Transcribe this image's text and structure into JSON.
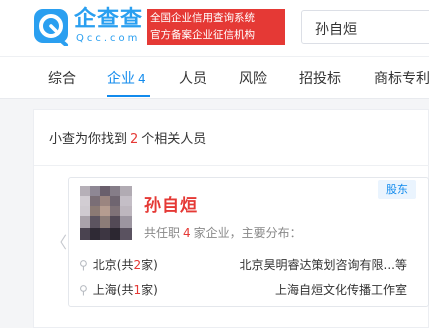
{
  "header": {
    "logo_text": "企查查",
    "logo_url": "Qcc.com",
    "slogan_line1": "全国企业信用查询系统",
    "slogan_line2": "官方备案企业征信机构",
    "search_value": "孙自烜"
  },
  "nav": {
    "tabs": [
      {
        "label": "综合"
      },
      {
        "label": "企业",
        "count": "4",
        "active": true
      },
      {
        "label": "人员"
      },
      {
        "label": "风险"
      },
      {
        "label": "招投标"
      },
      {
        "label": "商标专利"
      }
    ]
  },
  "results": {
    "prefix": "小查为你找到",
    "count": "2",
    "suffix": "个相关人员"
  },
  "person": {
    "name": "孙自烜",
    "tag": "股东",
    "info_prefix": "共任职",
    "info_count": "4",
    "info_suffix": "家企业，主要分布：",
    "locations": [
      {
        "city": "北京(共",
        "n": "2",
        "close": "家)",
        "company": "北京昊明睿达策划咨询有限...等"
      },
      {
        "city": "上海(共",
        "n": "1",
        "close": "家)",
        "company": "上海自烜文化传播工作室"
      }
    ]
  },
  "colors": {
    "brand": "#128bed",
    "accent_red": "#e53935"
  }
}
